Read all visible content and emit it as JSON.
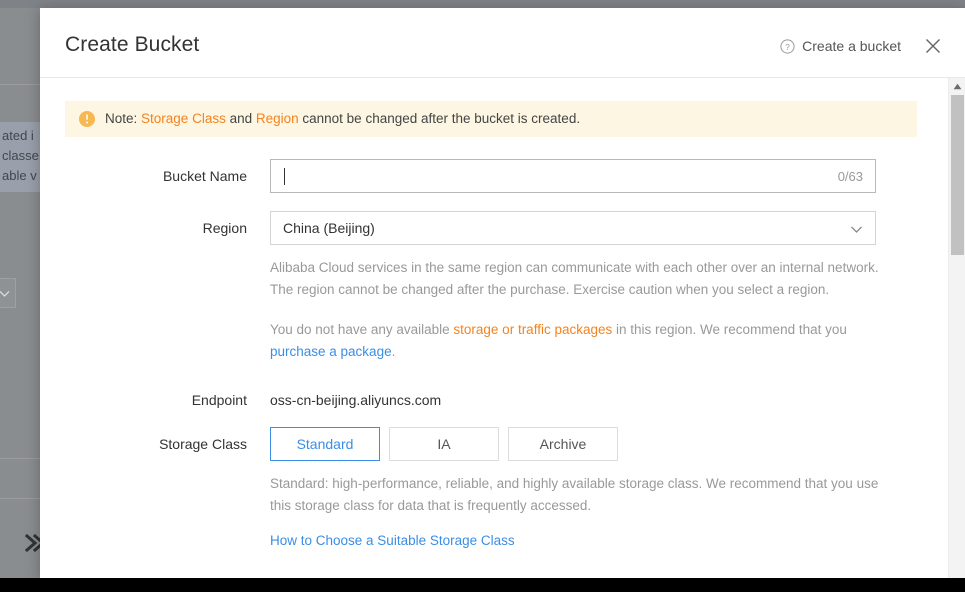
{
  "background": {
    "text_fragments": [
      "ated i",
      "classe",
      "able v"
    ],
    "expand_icon": "double-chevron-right-icon",
    "select_icon": "chevron-down-icon"
  },
  "modal": {
    "title": "Create Bucket",
    "help_link": {
      "icon": "question-circle-icon",
      "label": "Create a bucket"
    },
    "close_icon": "close-icon",
    "notice": {
      "icon": "warning-circle-icon",
      "prefix": "Note: ",
      "highlight_1": "Storage Class",
      "middle": " and ",
      "highlight_2": "Region",
      "suffix": " cannot be changed after the bucket is created.",
      "background_color": "#fdf6e3",
      "highlight_color": "#f5821f"
    },
    "fields": {
      "bucket_name": {
        "label": "Bucket Name",
        "value": "",
        "char_count": "0/63"
      },
      "region": {
        "label": "Region",
        "value": "China (Beijing)",
        "caret_icon": "chevron-down-icon",
        "helper_1": "Alibaba Cloud services in the same region can communicate with each other over an internal network. The region cannot be changed after the purchase. Exercise caution when you select a region.",
        "helper_2_part_1": "You do not have any available ",
        "helper_2_orange": "storage or traffic packages",
        "helper_2_part_2": " in this region. We recommend that you ",
        "helper_2_link": "purchase a package",
        "helper_2_part_3": "."
      },
      "endpoint": {
        "label": "Endpoint",
        "value": "oss-cn-beijing.aliyuncs.com"
      },
      "storage_class": {
        "label": "Storage Class",
        "options": [
          "Standard",
          "IA",
          "Archive"
        ],
        "selected": "Standard",
        "helper": "Standard: high-performance, reliable, and highly available storage class. We recommend that you use this storage class for data that is frequently accessed.",
        "link": "How to Choose a Suitable Storage Class"
      }
    },
    "accent_color": "#3a8ee6",
    "scrollbar": {
      "up_arrow_icon": "triangle-up-icon"
    }
  }
}
